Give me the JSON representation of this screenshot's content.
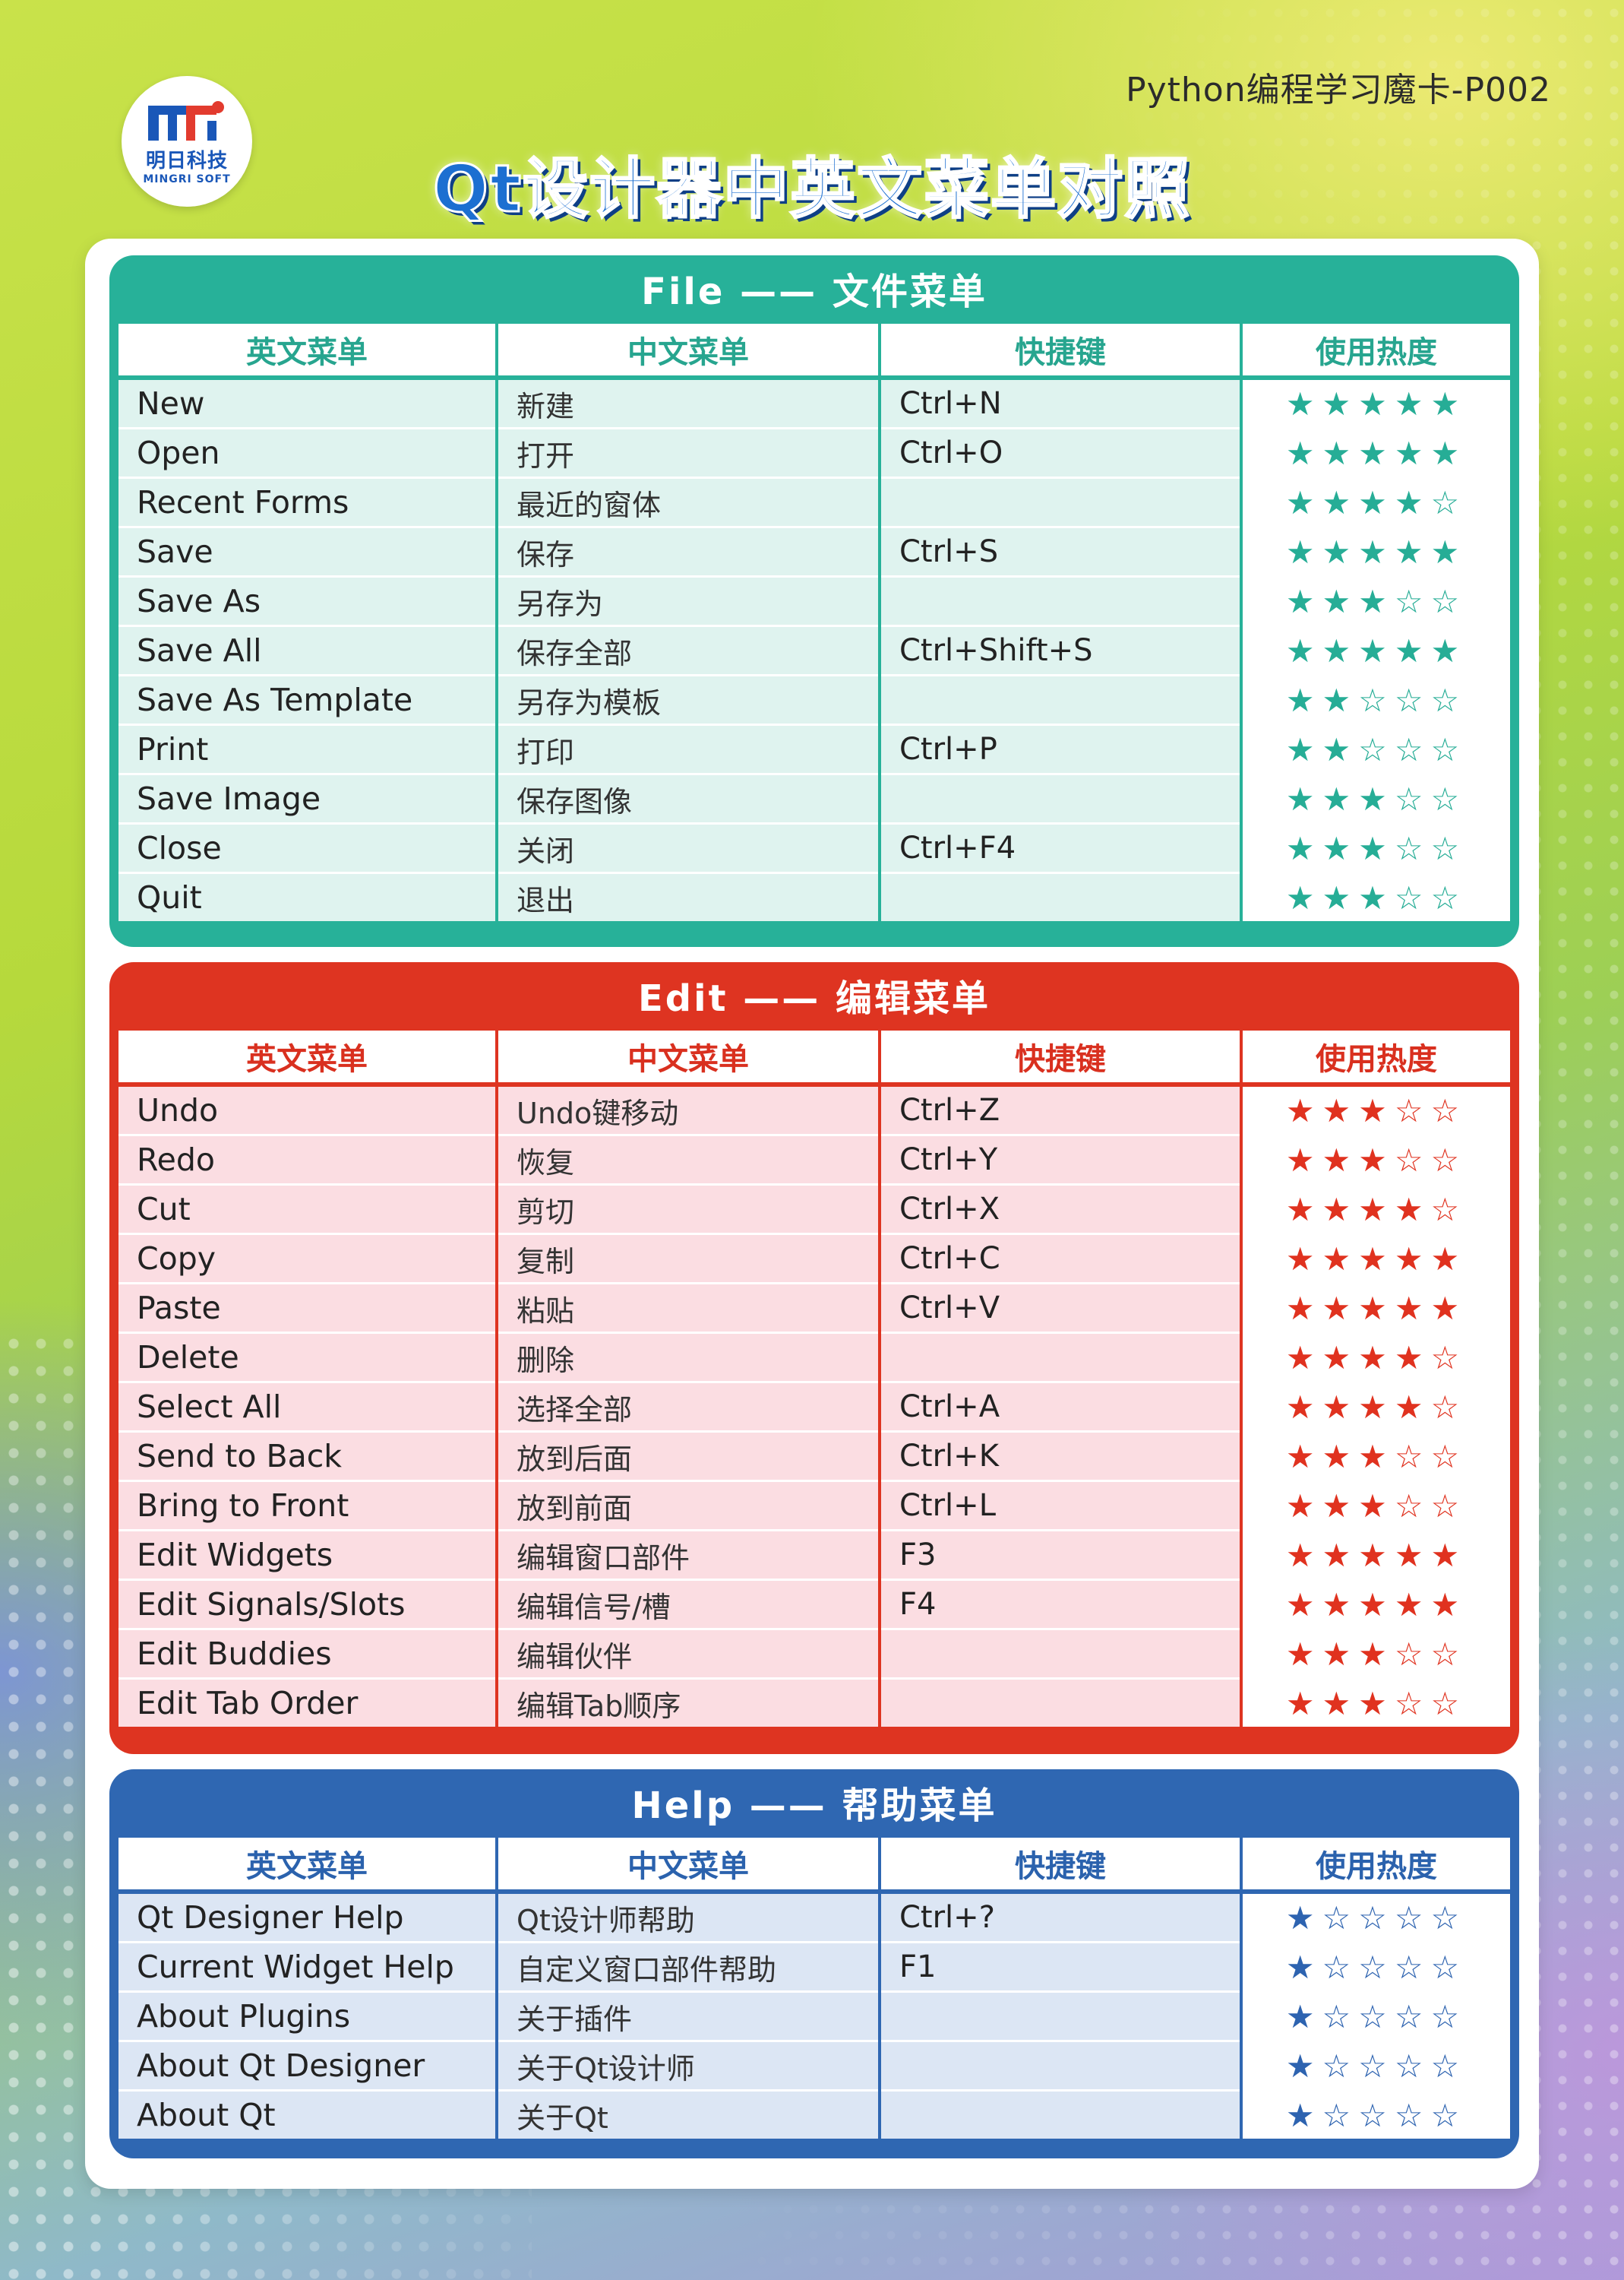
{
  "header": {
    "card_id": "Python编程学习魔卡-P002",
    "title": "Qt设计器中英文菜单对照",
    "logo_cn": "明日科技",
    "logo_en": "MINGRI SOFT"
  },
  "colors": {
    "file": "#27b199",
    "edit": "#de3421",
    "help": "#2f67b2"
  },
  "columns": [
    "英文菜单",
    "中文菜单",
    "快捷键",
    "使用热度"
  ],
  "sections": [
    {
      "key": "file",
      "title": "File —— 文件菜单",
      "rows": [
        {
          "en": "New",
          "cn": "新建",
          "shortcut": "Ctrl+N",
          "rating": 5
        },
        {
          "en": "Open",
          "cn": "打开",
          "shortcut": "Ctrl+O",
          "rating": 5
        },
        {
          "en": "Recent Forms",
          "cn": "最近的窗体",
          "shortcut": "",
          "rating": 4
        },
        {
          "en": "Save",
          "cn": "保存",
          "shortcut": "Ctrl+S",
          "rating": 5
        },
        {
          "en": "Save As",
          "cn": "另存为",
          "shortcut": "",
          "rating": 3
        },
        {
          "en": "Save All",
          "cn": "保存全部",
          "shortcut": "Ctrl+Shift+S",
          "rating": 5
        },
        {
          "en": "Save As Template",
          "cn": "另存为模板",
          "shortcut": "",
          "rating": 2
        },
        {
          "en": "Print",
          "cn": "打印",
          "shortcut": "Ctrl+P",
          "rating": 2
        },
        {
          "en": "Save Image",
          "cn": "保存图像",
          "shortcut": "",
          "rating": 3
        },
        {
          "en": "Close",
          "cn": "关闭",
          "shortcut": "Ctrl+F4",
          "rating": 3
        },
        {
          "en": "Quit",
          "cn": "退出",
          "shortcut": "",
          "rating": 3
        }
      ]
    },
    {
      "key": "edit",
      "title": "Edit —— 编辑菜单",
      "rows": [
        {
          "en": "Undo",
          "cn": "Undo键移动",
          "shortcut": "Ctrl+Z",
          "rating": 3
        },
        {
          "en": "Redo",
          "cn": "恢复",
          "shortcut": "Ctrl+Y",
          "rating": 3
        },
        {
          "en": "Cut",
          "cn": "剪切",
          "shortcut": "Ctrl+X",
          "rating": 4
        },
        {
          "en": "Copy",
          "cn": "复制",
          "shortcut": "Ctrl+C",
          "rating": 5
        },
        {
          "en": "Paste",
          "cn": "粘贴",
          "shortcut": "Ctrl+V",
          "rating": 5
        },
        {
          "en": "Delete",
          "cn": "删除",
          "shortcut": "",
          "rating": 4
        },
        {
          "en": "Select All",
          "cn": "选择全部",
          "shortcut": "Ctrl+A",
          "rating": 4
        },
        {
          "en": "Send to Back",
          "cn": "放到后面",
          "shortcut": "Ctrl+K",
          "rating": 3
        },
        {
          "en": "Bring to Front",
          "cn": "放到前面",
          "shortcut": "Ctrl+L",
          "rating": 3
        },
        {
          "en": "Edit Widgets",
          "cn": "编辑窗口部件",
          "shortcut": "F3",
          "rating": 5
        },
        {
          "en": "Edit Signals/Slots",
          "cn": "编辑信号/槽",
          "shortcut": "F4",
          "rating": 5
        },
        {
          "en": "Edit Buddies",
          "cn": "编辑伙伴",
          "shortcut": "",
          "rating": 3
        },
        {
          "en": "Edit Tab Order",
          "cn": "编辑Tab顺序",
          "shortcut": "",
          "rating": 3
        }
      ]
    },
    {
      "key": "help",
      "title": "Help —— 帮助菜单",
      "rows": [
        {
          "en": "Qt Designer Help",
          "cn": "Qt设计师帮助",
          "shortcut": "Ctrl+?",
          "rating": 1
        },
        {
          "en": "Current Widget Help",
          "cn": "自定义窗口部件帮助",
          "shortcut": "F1",
          "rating": 1
        },
        {
          "en": "About Plugins",
          "cn": "关于插件",
          "shortcut": "",
          "rating": 1
        },
        {
          "en": "About Qt Designer",
          "cn": "关于Qt设计师",
          "shortcut": "",
          "rating": 1
        },
        {
          "en": "About Qt",
          "cn": "关于Qt",
          "shortcut": "",
          "rating": 1
        }
      ]
    }
  ]
}
